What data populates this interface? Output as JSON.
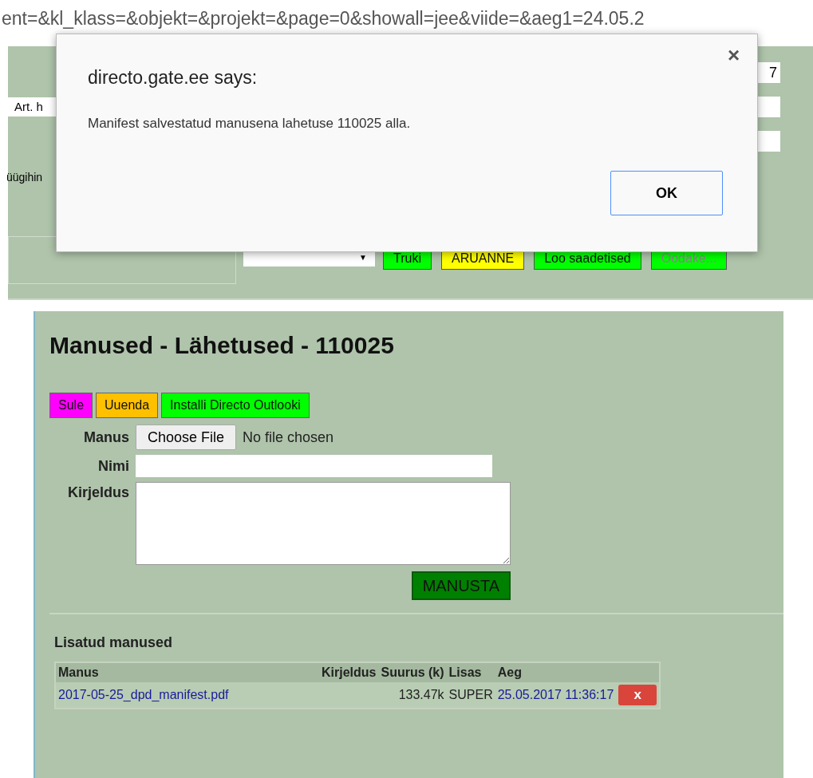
{
  "address_bar": {
    "url": "ent=&kl_klass=&objekt=&projekt=&page=0&showall=jee&viide=&aeg1=24.05.2"
  },
  "background_page": {
    "article_field": "Art. h",
    "side_label": "üügihin",
    "right_fields": [
      {
        "kind": "field",
        "value": "7"
      },
      {
        "kind": "field"
      },
      {
        "kind": "field"
      }
    ],
    "dropdown_arrow": "▼",
    "buttons": [
      {
        "label": "Truki",
        "color": "#00ff00",
        "disabled": false
      },
      {
        "label": "ARUANNE",
        "color": "#ffff00",
        "disabled": false
      },
      {
        "label": "Loo saadetised",
        "color": "#00ff00",
        "disabled": false
      },
      {
        "label": "Oodake...",
        "color": "#00ff00",
        "disabled": true
      }
    ]
  },
  "dialog": {
    "title": "directo.gate.ee says:",
    "message": "Manifest salvestatud manusena lahetuse 110025 alla.",
    "close": "×",
    "button": "OK"
  },
  "attachments": {
    "title": "Manused - Lähetused - 110025",
    "buttons": [
      {
        "label": "Sule",
        "color": "#ff00ff"
      },
      {
        "label": "Uuenda",
        "color": "#ffc000"
      },
      {
        "label": "Installi Directo Outlooki",
        "color": "#00ff00"
      }
    ],
    "file_label": "Manus",
    "file_button": "Choose File",
    "file_status": "No file chosen",
    "name_label": "Nimi",
    "description_label": "Kirjeldus",
    "submit": "MANUSTA",
    "list_title": "Lisatud manused",
    "table": {
      "columns": [
        "Manus",
        "Kirjeldus",
        "Suurus (k)",
        "Lisas",
        "Aeg"
      ],
      "rows": [
        {
          "file": "2017-05-25_dpd_manifest.pdf",
          "size": "133.47k",
          "added_by": "SUPER",
          "time": "25.05.2017 11:36:17",
          "delete": "x"
        }
      ]
    }
  }
}
